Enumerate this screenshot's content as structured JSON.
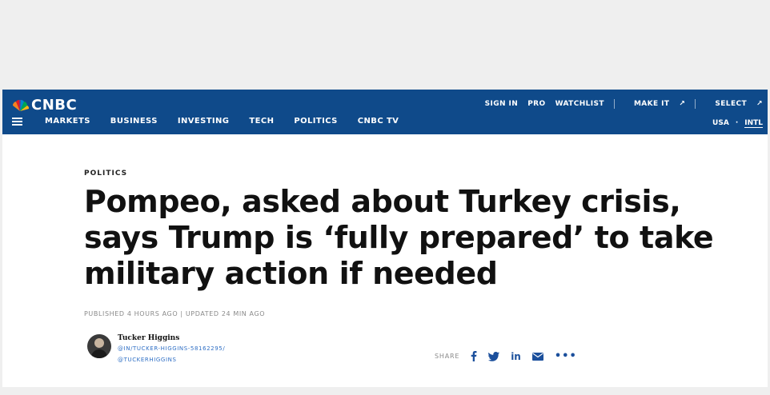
{
  "header": {
    "brand": "CNBC",
    "top_links": [
      "SIGN IN",
      "PRO",
      "WATCHLIST",
      "MAKE IT",
      "SELECT"
    ],
    "menu": [
      "MARKETS",
      "BUSINESS",
      "INVESTING",
      "TECH",
      "POLITICS",
      "CNBC TV"
    ],
    "region": [
      "USA",
      "INTL"
    ]
  },
  "article": {
    "kicker": "POLITICS",
    "headline": "Pompeo, asked about Turkey crisis, says Trump is ‘fully prepared’ to take military action if needed",
    "meta": "PUBLISHED 4 HOURS AGO | UPDATED 24 MIN AGO",
    "author": {
      "name": "Tucker Higgins",
      "linkedin": "@IN/TUCKER-HIGGINS-58162295/",
      "twitter": "@TUCKERHIGGINS"
    },
    "share_label": "SHARE"
  },
  "colors": {
    "header_bg": "#0f4a8a",
    "page_bg": "#efefef"
  }
}
